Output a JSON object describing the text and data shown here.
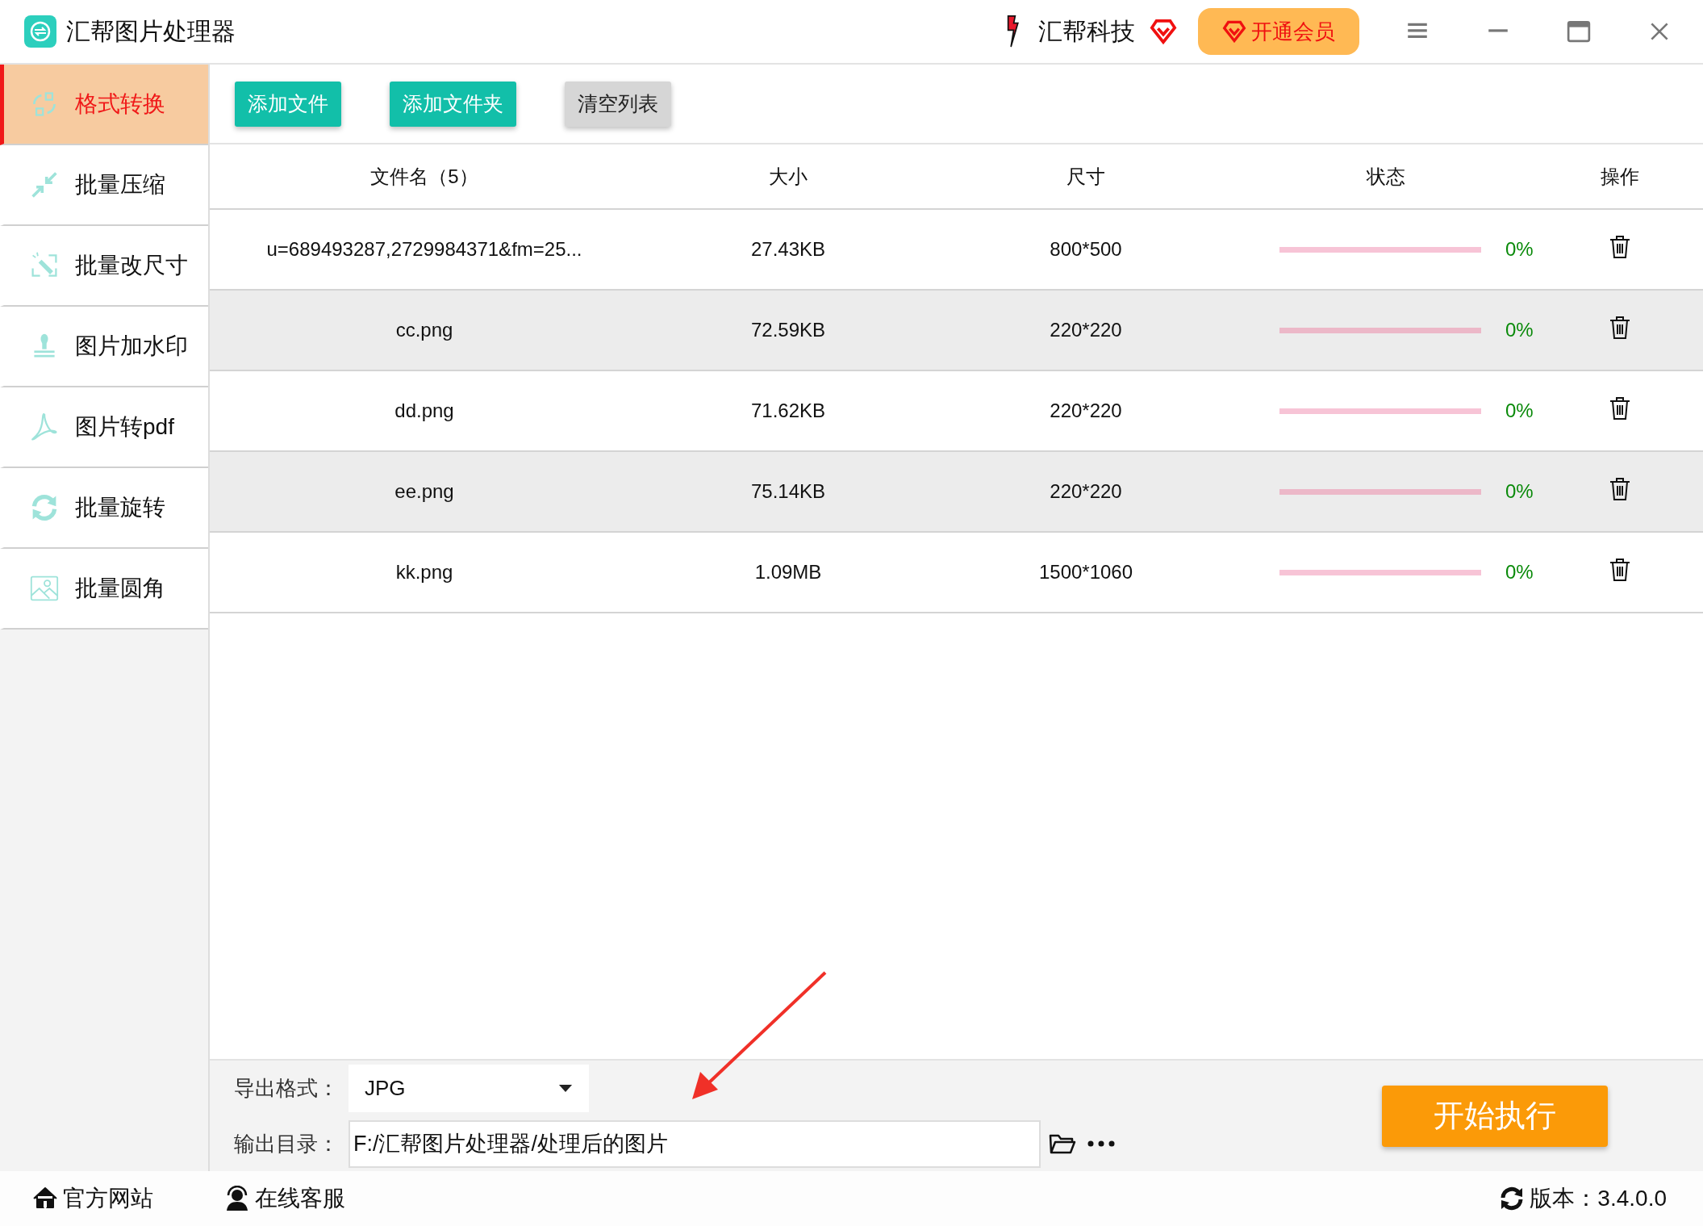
{
  "window": {
    "title": "汇帮图片处理器"
  },
  "header": {
    "brand": "汇帮科技",
    "vip_button": "开通会员"
  },
  "sidebar": {
    "items": [
      {
        "label": "格式转换",
        "selected": true
      },
      {
        "label": "批量压缩",
        "selected": false
      },
      {
        "label": "批量改尺寸",
        "selected": false
      },
      {
        "label": "图片加水印",
        "selected": false
      },
      {
        "label": "图片转pdf",
        "selected": false
      },
      {
        "label": "批量旋转",
        "selected": false
      },
      {
        "label": "批量圆角",
        "selected": false
      }
    ]
  },
  "toolbar": {
    "buttons": [
      {
        "label": "添加文件",
        "kind": "primary"
      },
      {
        "label": "添加文件夹",
        "kind": "primary"
      },
      {
        "label": "清空列表",
        "kind": "secondary"
      }
    ]
  },
  "table": {
    "columns": [
      "文件名（5）",
      "大小",
      "尺寸",
      "状态",
      "操作"
    ],
    "rows": [
      {
        "name": "u=689493287,2729984371&fm=25...",
        "size": "27.43KB",
        "dimensions": "800*500",
        "level": 0,
        "progress": "0%"
      },
      {
        "name": "cc.png",
        "size": "72.59KB",
        "dimensions": "220*220",
        "level": 0,
        "progress": "0%"
      },
      {
        "name": "dd.png",
        "size": "71.62KB",
        "dimensions": "220*220",
        "level": 0,
        "progress": "0%"
      },
      {
        "name": "ee.png",
        "size": "75.14KB",
        "dimensions": "220*220",
        "level": 0,
        "progress": "0%"
      },
      {
        "name": "kk.png",
        "size": "1.09MB",
        "dimensions": "1500*1060",
        "level": 0,
        "progress": "0%"
      }
    ]
  },
  "export": {
    "format_label": "导出格式：",
    "format": "JPG",
    "output_label": "输出目录：",
    "output_path": "F:/汇帮图片处理器/处理后的图片"
  },
  "start_button": "开始执行",
  "footer": {
    "links": [
      "官方网站",
      "在线客服"
    ],
    "version": "版本：3.4.0.0"
  }
}
